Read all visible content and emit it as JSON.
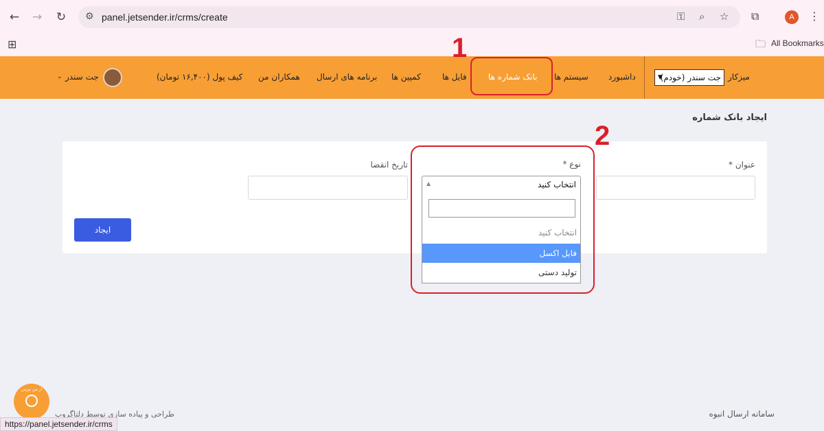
{
  "browser": {
    "url": "panel.jetsender.ir/crms/create",
    "bookmarks_label": "All Bookmarks",
    "profile_initial": "A",
    "status_url": "https://panel.jetsender.ir/crms"
  },
  "header": {
    "brand": "میزکار",
    "account_select": "جت سندر (خودم)",
    "menu": [
      "داشبورد",
      "سیستم ها",
      "بانک شماره ها",
      "فایل ها",
      "کمپین ها",
      "برنامه های ارسال",
      "همکاران من",
      "کیف پول (۱۶,۴۰۰ تومان)"
    ],
    "active_index": 2,
    "user_name": "جت سندر"
  },
  "annotations": [
    "1",
    "2"
  ],
  "page": {
    "title": "ایجاد بانک شماره",
    "form": {
      "title_label": "عنوان *",
      "type_label": "نوع *",
      "expiry_label": "تاریخ انقضا",
      "type_selected": "انتخاب کنید",
      "options": [
        "انتخاب کنید",
        "فایل اکسل",
        "تولید دستی"
      ],
      "highlighted_option": 1,
      "submit": "ایجاد"
    }
  },
  "footer": {
    "site_name": "سامانه ارسال انبوه",
    "credit": "طراحی و پیاده سازی توسط دلتاگروپ",
    "support_label": "از من بپرس"
  },
  "colors": {
    "header_bg": "#f79e35",
    "primary_button": "#3a5ce0",
    "highlight": "#5897fb",
    "annotation": "#d8202a"
  }
}
